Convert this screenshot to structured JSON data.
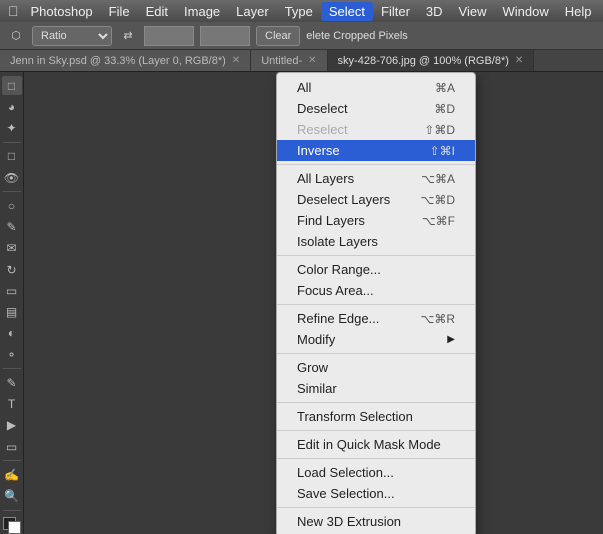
{
  "app": {
    "name": "Photoshop"
  },
  "menubar": {
    "apple": "⌘",
    "items": [
      {
        "label": "Photoshop",
        "active": false
      },
      {
        "label": "File",
        "active": false
      },
      {
        "label": "Edit",
        "active": false
      },
      {
        "label": "Image",
        "active": false
      },
      {
        "label": "Layer",
        "active": false
      },
      {
        "label": "Type",
        "active": false
      },
      {
        "label": "Select",
        "active": true
      },
      {
        "label": "Filter",
        "active": false
      },
      {
        "label": "3D",
        "active": false
      },
      {
        "label": "View",
        "active": false
      },
      {
        "label": "Window",
        "active": false
      },
      {
        "label": "Help",
        "active": false
      }
    ]
  },
  "toolbar": {
    "ratio_label": "Ratio",
    "clear_btn": "Clear",
    "delete_cropped_label": "elete Cropped Pixels"
  },
  "tabs": [
    {
      "label": "Jenn in Sky.psd @ 33.3% (Layer 0, RGB/8*)",
      "active": false
    },
    {
      "label": "Untitled-",
      "active": false
    },
    {
      "label": "sky-428-706.jpg @ 100% (RGB/8*)",
      "active": false
    }
  ],
  "dropdown": {
    "items": [
      {
        "label": "All",
        "shortcut": "⌘A",
        "type": "item"
      },
      {
        "label": "Deselect",
        "shortcut": "⌘D",
        "type": "item"
      },
      {
        "label": "Reselect",
        "shortcut": "⇧⌘D",
        "type": "item",
        "disabled": true
      },
      {
        "label": "Inverse",
        "shortcut": "⇧⌘I",
        "type": "item",
        "highlighted": true
      },
      {
        "type": "separator"
      },
      {
        "label": "All Layers",
        "shortcut": "⌥⌘A",
        "type": "item"
      },
      {
        "label": "Deselect Layers",
        "shortcut": "⌥⌘D",
        "type": "item"
      },
      {
        "label": "Find Layers",
        "shortcut": "⌥⌘F",
        "type": "item"
      },
      {
        "label": "Isolate Layers",
        "type": "item"
      },
      {
        "type": "separator"
      },
      {
        "label": "Color Range...",
        "type": "item"
      },
      {
        "label": "Focus Area...",
        "type": "item"
      },
      {
        "type": "separator"
      },
      {
        "label": "Refine Edge...",
        "shortcut": "⌥⌘R",
        "type": "item"
      },
      {
        "label": "Modify",
        "arrow": true,
        "type": "item"
      },
      {
        "type": "separator"
      },
      {
        "label": "Grow",
        "type": "item"
      },
      {
        "label": "Similar",
        "type": "item"
      },
      {
        "type": "separator"
      },
      {
        "label": "Transform Selection",
        "type": "item"
      },
      {
        "type": "separator"
      },
      {
        "label": "Edit in Quick Mask Mode",
        "type": "item"
      },
      {
        "type": "separator"
      },
      {
        "label": "Load Selection...",
        "type": "item"
      },
      {
        "label": "Save Selection...",
        "type": "item"
      },
      {
        "type": "separator"
      },
      {
        "label": "New 3D Extrusion",
        "type": "item"
      }
    ]
  }
}
